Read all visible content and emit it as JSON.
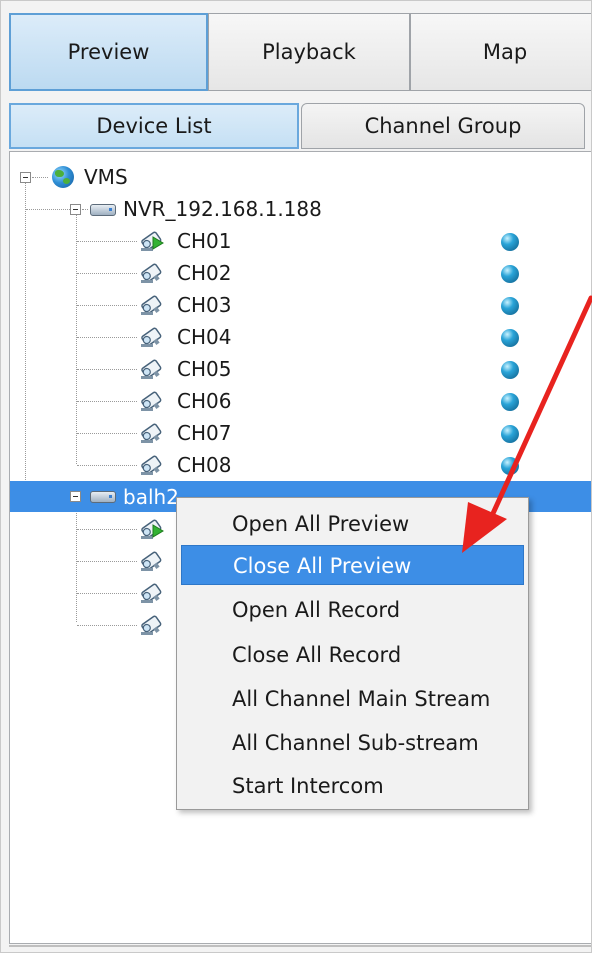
{
  "top_tabs": [
    {
      "label": "Preview",
      "active": true
    },
    {
      "label": "Playback",
      "active": false
    },
    {
      "label": "Map",
      "active": false
    }
  ],
  "sub_tabs": [
    {
      "label": "Device List",
      "active": true
    },
    {
      "label": "Channel Group",
      "active": false
    }
  ],
  "tree": {
    "root": {
      "label": "VMS",
      "icon": "globe-icon"
    },
    "devices": [
      {
        "label": "NVR_192.168.1.188",
        "icon": "nvr-icon",
        "channels": [
          {
            "label": "CH01",
            "icon": "camera-playing-icon",
            "status": "online"
          },
          {
            "label": "CH02",
            "icon": "camera-icon",
            "status": "online"
          },
          {
            "label": "CH03",
            "icon": "camera-icon",
            "status": "online"
          },
          {
            "label": "CH04",
            "icon": "camera-icon",
            "status": "online"
          },
          {
            "label": "CH05",
            "icon": "camera-icon",
            "status": "online"
          },
          {
            "label": "CH06",
            "icon": "camera-icon",
            "status": "online"
          },
          {
            "label": "CH07",
            "icon": "camera-icon",
            "status": "online"
          },
          {
            "label": "CH08",
            "icon": "camera-icon",
            "status": "online"
          }
        ]
      },
      {
        "label": "balh2",
        "icon": "nvr-icon",
        "selected": true,
        "channel_count_visible": 4
      }
    ]
  },
  "context_menu": {
    "items": [
      {
        "label": "Open All Preview",
        "highlighted": false
      },
      {
        "label": "Close All Preview",
        "highlighted": true
      },
      {
        "label": "Open All Record",
        "highlighted": false
      },
      {
        "label": "Close All Record",
        "highlighted": false
      },
      {
        "label": "All Channel Main Stream",
        "highlighted": false
      },
      {
        "label": "All Channel Sub-stream",
        "highlighted": false
      },
      {
        "label": "Start Intercom",
        "highlighted": false
      }
    ]
  },
  "colors": {
    "accent": "#3d8ee6",
    "annotation_arrow": "#e8231f",
    "status_online": "#2aa4d8"
  }
}
